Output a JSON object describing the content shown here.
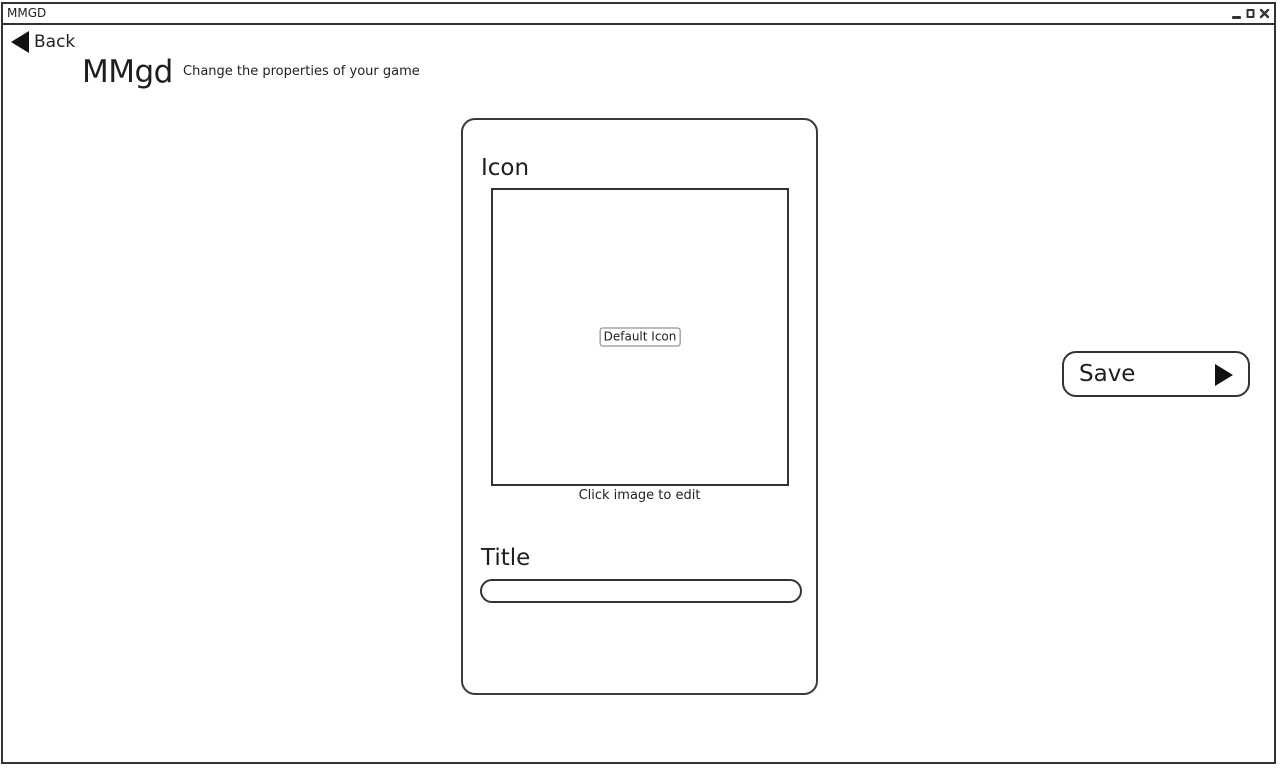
{
  "window": {
    "title": "MMGD",
    "controls": {
      "minimize_icon": "minimize-icon",
      "maximize_icon": "maximize-icon",
      "close_icon": "close-icon"
    }
  },
  "header": {
    "back_label": "Back",
    "back_icon": "left-triangle-icon",
    "app_title": "MMgd",
    "subtitle": "Change the properties of your game"
  },
  "card": {
    "icon_heading": "Icon",
    "default_icon_label": "Default Icon",
    "icon_hint": "Click image to edit",
    "title_heading": "Title",
    "title_value": "",
    "title_placeholder": ""
  },
  "actions": {
    "save_label": "Save",
    "save_icon": "right-triangle-icon"
  },
  "colors": {
    "ink": "#333333",
    "background": "#ffffff"
  }
}
